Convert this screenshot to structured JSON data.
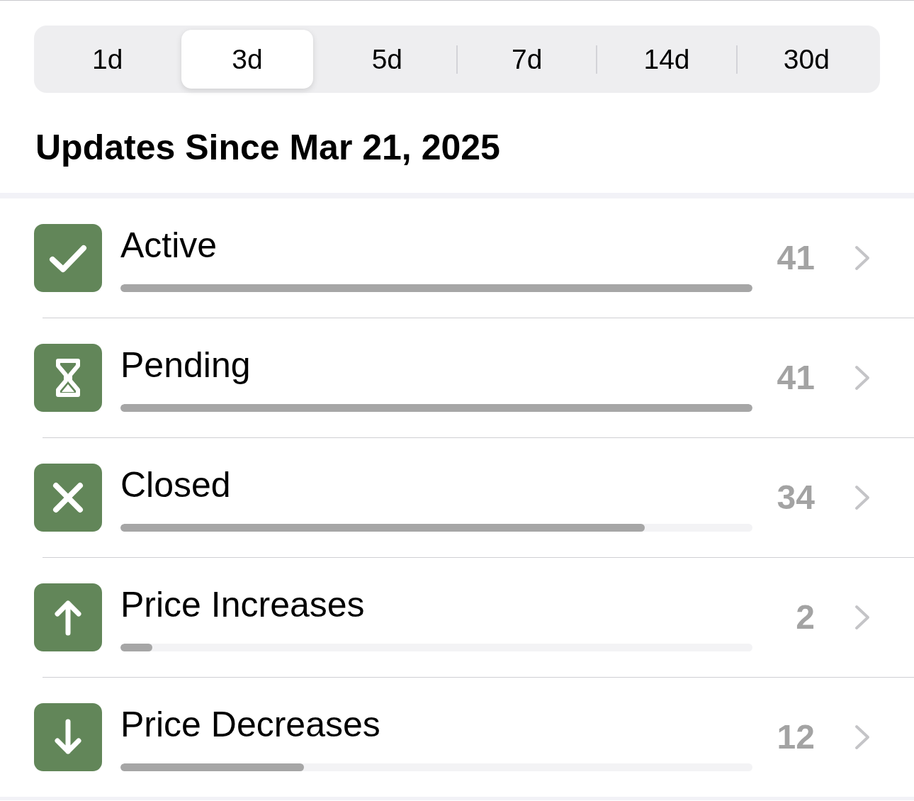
{
  "segments": [
    {
      "label": "1d",
      "selected": false
    },
    {
      "label": "3d",
      "selected": true
    },
    {
      "label": "5d",
      "selected": false
    },
    {
      "label": "7d",
      "selected": false
    },
    {
      "label": "14d",
      "selected": false
    },
    {
      "label": "30d",
      "selected": false
    }
  ],
  "section_title": "Updates Since Mar 21, 2025",
  "rows": [
    {
      "kind": "check",
      "label": "Active",
      "count": "41",
      "level": 1
    },
    {
      "kind": "hourglass",
      "label": "Pending",
      "count": "41",
      "level": 1
    },
    {
      "kind": "cross",
      "label": "Closed",
      "count": "34",
      "level": 0.83
    },
    {
      "kind": "up",
      "label": "Price Increases",
      "count": "2",
      "level": 0.05
    },
    {
      "kind": "down",
      "label": "Price Decreases",
      "count": "12",
      "level": 0.29
    }
  ]
}
